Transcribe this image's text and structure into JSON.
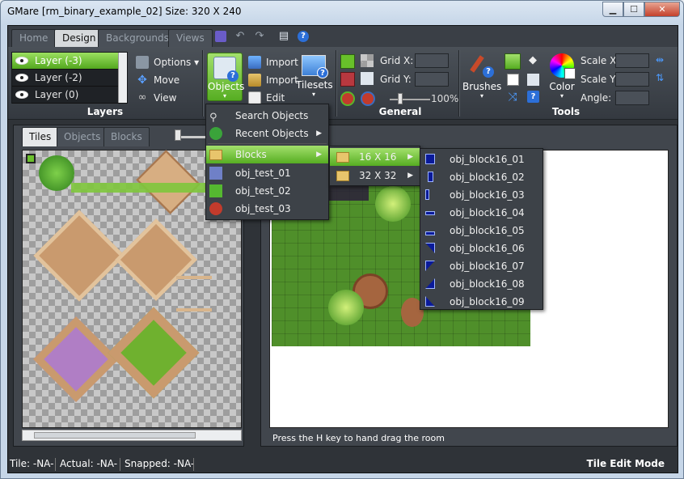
{
  "window": {
    "title": "GMare [rm_binary_example_02] Size: 320 X 240",
    "minimize_icon": "minimize-icon",
    "maximize_icon": "maximize-icon",
    "close_icon": "close-icon"
  },
  "main_tabs": [
    {
      "label": "Home",
      "active": false
    },
    {
      "label": "Design",
      "active": true
    },
    {
      "label": "Backgrounds",
      "active": false
    },
    {
      "label": "Views",
      "active": false
    }
  ],
  "quick_access": [
    "save-icon",
    "undo-icon",
    "redo-icon",
    "book-icon",
    "help-icon"
  ],
  "layers": {
    "items": [
      {
        "label": "Layer (-3)",
        "selected": true
      },
      {
        "label": "Layer (-2)",
        "selected": false
      },
      {
        "label": "Layer (0)",
        "selected": false
      }
    ],
    "options_label": "Options",
    "move_label": "Move",
    "view_label": "View",
    "group_label": "Layers"
  },
  "objects_group": {
    "objects_label": "Objects",
    "import1_label": "Import",
    "import2_label": "Import",
    "edit_label": "Edit",
    "tilesets_label": "Tilesets"
  },
  "general": {
    "grid_x_label": "Grid X:",
    "grid_y_label": "Grid Y:",
    "zoom": "100%",
    "group_label": "General"
  },
  "tools": {
    "brushes_label": "Brushes",
    "color_label": "Color",
    "scale_x_label": "Scale X:",
    "scale_y_label": "Scale Y:",
    "angle_label": "Angle:",
    "group_label": "Tools"
  },
  "left_panel": {
    "tabs": [
      {
        "label": "Tiles",
        "active": true
      },
      {
        "label": "Objects",
        "active": false
      },
      {
        "label": "Blocks",
        "active": false
      }
    ]
  },
  "objects_menu": {
    "items": [
      {
        "label": "Search Objects",
        "icon": "search-icon",
        "submenu": false
      },
      {
        "label": "Recent Objects",
        "icon": "clock-icon",
        "submenu": true
      },
      {
        "label": "Blocks",
        "icon": "folder-icon",
        "submenu": true,
        "highlighted": true
      },
      {
        "label": "obj_test_01",
        "icon": "object-icon",
        "submenu": false
      },
      {
        "label": "obj_test_02",
        "icon": "object-icon",
        "submenu": false
      },
      {
        "label": "obj_test_03",
        "icon": "object-icon",
        "submenu": false
      }
    ]
  },
  "blocks_menu": {
    "items": [
      {
        "label": "16 X 16",
        "highlighted": true
      },
      {
        "label": "32 X 32",
        "highlighted": false
      }
    ]
  },
  "size_menu": {
    "items": [
      "obj_block16_01",
      "obj_block16_02",
      "obj_block16_03",
      "obj_block16_04",
      "obj_block16_05",
      "obj_block16_06",
      "obj_block16_07",
      "obj_block16_08",
      "obj_block16_09"
    ]
  },
  "room_hint": "Press the H key to hand drag the room",
  "status": {
    "tile": "Tile: -NA-",
    "actual": "Actual: -NA-",
    "snapped": "Snapped: -NA-",
    "mode": "Tile Edit Mode"
  },
  "colors": {
    "accent": "#6cc12d",
    "background": "#2f3338"
  }
}
